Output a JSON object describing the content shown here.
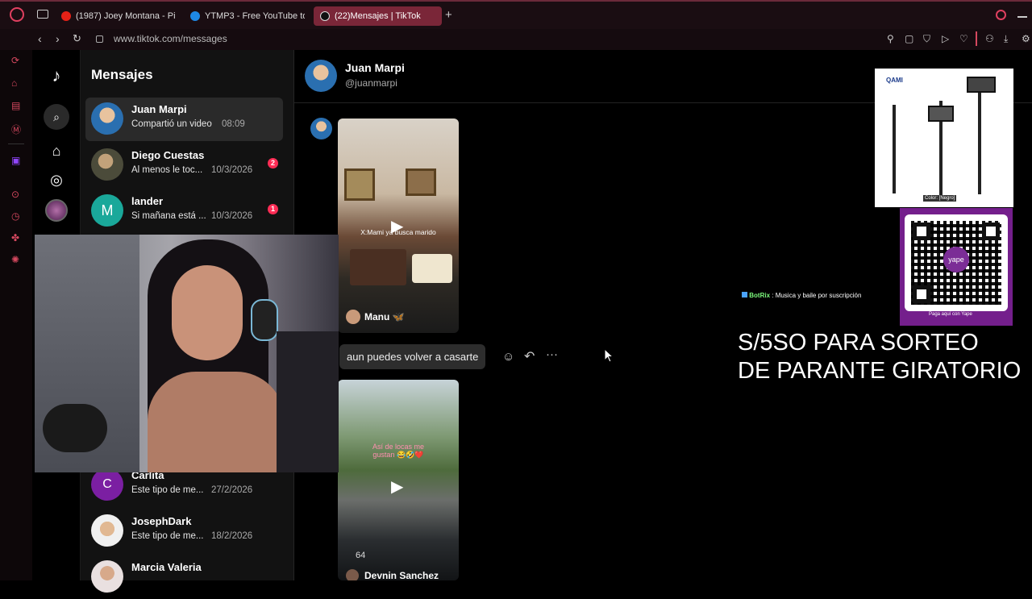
{
  "browser": {
    "tabs": [
      {
        "label": "(1987) Joey Montana - Pic",
        "favicon_color": "#e62117"
      },
      {
        "label": "YTMP3 - Free YouTube to",
        "favicon_color": "#1e88e5"
      },
      {
        "label": "(22)Mensajes | TikTok",
        "favicon_color": "#111111",
        "active": true
      }
    ],
    "new_tab_label": "+",
    "url": "www.tiktok.com/messages"
  },
  "colors": {
    "accent": "#fe2c55",
    "tab_active": "#7a2638",
    "panel": "#121212"
  },
  "tiktok": {
    "heading": "Mensajes",
    "conversations": [
      {
        "name": "Juan Marpi",
        "preview": "Compartió un video",
        "time": "08:09",
        "active": true
      },
      {
        "name": "Diego Cuestas",
        "preview": "Al menos le toc...",
        "time": "10/3/2026",
        "badge": "2"
      },
      {
        "name": "lander",
        "preview": "Si mañana está ...",
        "time": "10/3/2026",
        "badge": "1",
        "initial": "M"
      },
      {
        "name": "Carlita",
        "preview": "Este tipo de me...",
        "time": "27/2/2026",
        "initial": "C"
      },
      {
        "name": "JosephDark",
        "preview": "Este tipo de me...",
        "time": "18/2/2026"
      },
      {
        "name": "Marcia Valeria",
        "preview": "",
        "time": ""
      }
    ],
    "chat": {
      "contact_name": "Juan Marpi",
      "contact_handle": "@juanmarpi",
      "video1_caption": "X:Mami ya busca marido",
      "video1_author": "Manu 🦋",
      "message": "aun puedes volver a casarte",
      "video2_caption": "Así de locas me gustan 😂🤣❤️",
      "video2_author": "Devnin Sanchez",
      "video2_speed": "64"
    }
  },
  "overlays": {
    "product_brand": "QAMI",
    "product_color_label": "Color: [Negro]",
    "qr_caption": "Paga aquí con Yape",
    "qr_logo": "yape",
    "botrix_name": "BotRix",
    "botrix_text": ": Musica y baile por suscripción",
    "promo_line1": "S/5SO PARA SORTEO",
    "promo_line2": "DE PARANTE GIRATORIO"
  }
}
